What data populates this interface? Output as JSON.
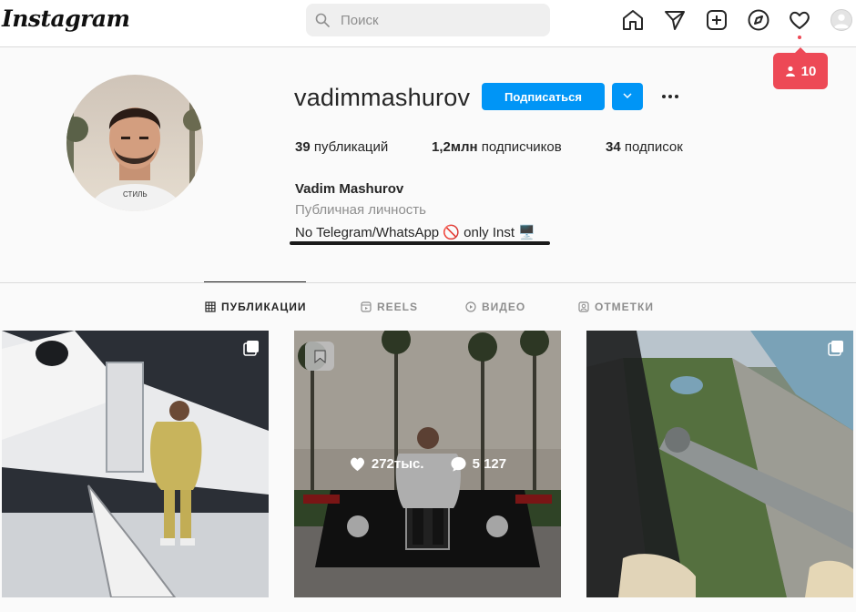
{
  "app": {
    "logo": "Instagram"
  },
  "search": {
    "placeholder": "Поиск"
  },
  "nav": {
    "icons": [
      "home-icon",
      "direct-icon",
      "new-post-icon",
      "explore-icon",
      "activity-icon",
      "profile-icon"
    ]
  },
  "notification": {
    "count": "10",
    "color": "#ed4956"
  },
  "profile": {
    "username": "vadimmashurov",
    "follow_label": "Подписаться",
    "stats": {
      "posts_count": "39",
      "posts_label": "публикаций",
      "followers_count": "1,2млн",
      "followers_label": "подписчиков",
      "following_count": "34",
      "following_label": "подписок"
    },
    "full_name": "Vadim Mashurov",
    "category": "Публичная личность",
    "bio": "No Telegram/WhatsApp 🚫 only Inst 🖥️"
  },
  "tabs": [
    {
      "label": "ПУБЛИКАЦИИ",
      "icon": "grid-icon",
      "active": true
    },
    {
      "label": "REELS",
      "icon": "reels-icon",
      "active": false
    },
    {
      "label": "ВИДЕО",
      "icon": "video-icon",
      "active": false
    },
    {
      "label": "ОТМЕТКИ",
      "icon": "tagged-icon",
      "active": false
    }
  ],
  "posts": [
    {
      "description_icon": "multiple-photos-icon"
    },
    {
      "likes": "272тыс.",
      "comments": "5 127"
    },
    {
      "description_icon": "multiple-photos-icon"
    }
  ],
  "colors": {
    "accent": "#0095f6",
    "background": "#fafafa",
    "border": "#dbdbdb"
  }
}
